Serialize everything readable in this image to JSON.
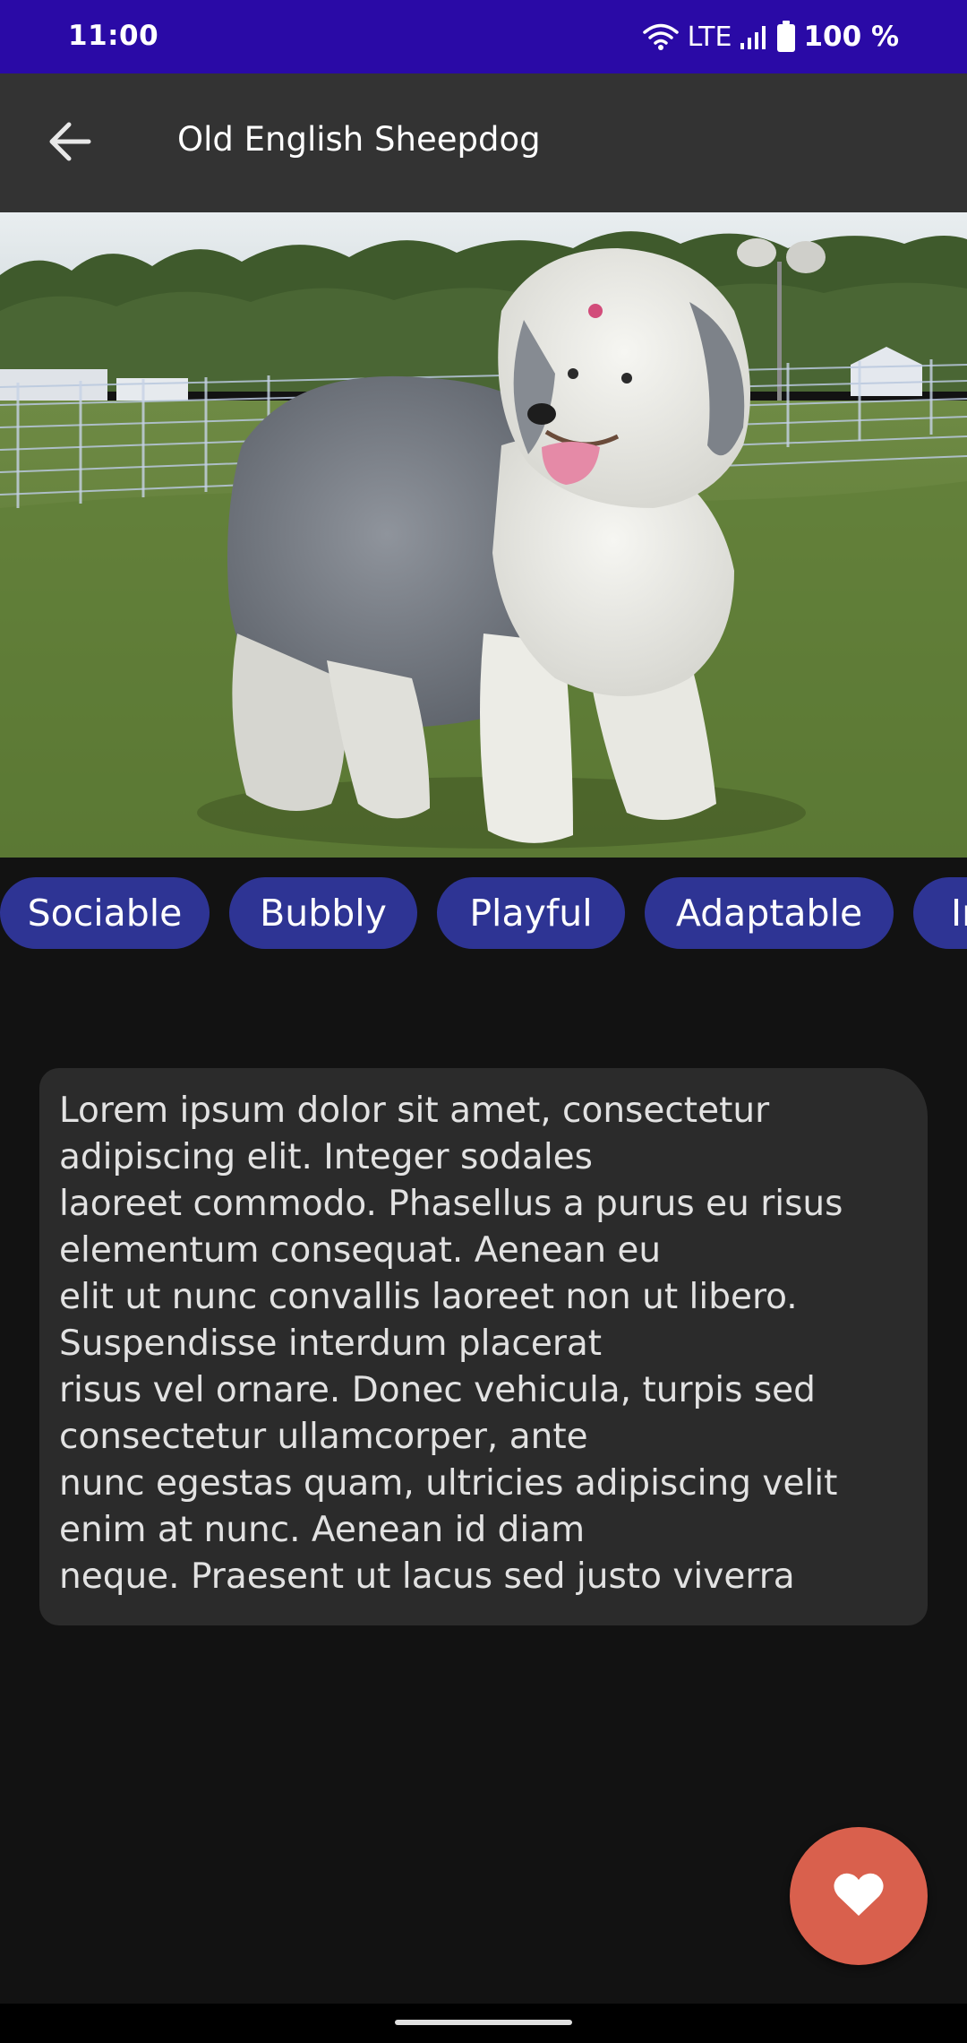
{
  "status_bar": {
    "time": "11:00",
    "network": "LTE",
    "battery": "100 %",
    "icons": [
      "wifi-icon",
      "signal-icon",
      "battery-icon"
    ],
    "background": "#2a0aa6"
  },
  "app_bar": {
    "title": "Old English Sheepdog",
    "back_icon": "arrow-back-icon",
    "background": "#333333"
  },
  "hero_image": {
    "subject": "Old English Sheepdog standing on grass"
  },
  "chips": [
    {
      "label": "Sociable"
    },
    {
      "label": "Bubbly"
    },
    {
      "label": "Playful"
    },
    {
      "label": "Adaptable"
    },
    {
      "label": "In"
    }
  ],
  "description": {
    "text": "Lorem ipsum dolor sit amet, consectetur\nadipiscing elit. Integer sodales\nlaoreet commodo. Phasellus a purus eu risus\nelementum consequat. Aenean eu\nelit ut nunc convallis laoreet non ut libero.\nSuspendisse interdum placerat\nrisus vel ornare. Donec vehicula, turpis sed\nconsectetur ullamcorper, ante\nnunc egestas quam, ultricies adipiscing velit\nenim at nunc. Aenean id diam\nneque. Praesent ut lacus sed justo viverra"
  },
  "fab": {
    "icon": "heart-icon",
    "color": "#d9604d"
  },
  "colors": {
    "chip": "#2e3494",
    "card": "#2b2b2b",
    "background": "#121212"
  }
}
